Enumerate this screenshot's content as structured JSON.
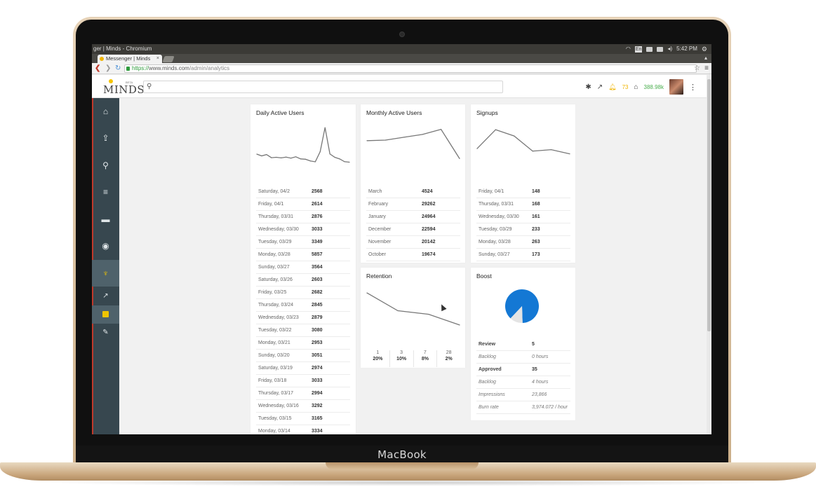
{
  "os": {
    "window_title": "ger | Minds - Chromium",
    "time": "5:42 PM",
    "keyboard": "En"
  },
  "browser": {
    "tab_title": "Messenger | Minds",
    "tab_close": "×",
    "url_scheme": "https://",
    "url_host": "www.minds.com",
    "url_path": "/admin/analytics"
  },
  "header": {
    "logo_text": "MINDS",
    "logo_badge": "BETA",
    "search_placeholder": "",
    "notifications": "73",
    "points": "388.98k"
  },
  "sidebar": {
    "items": [
      "home-icon",
      "upload-icon",
      "search-icon",
      "newsfeed-icon",
      "messenger-icon",
      "gatherings-icon",
      "admin-icon",
      "analytics-icon",
      "boost-admin-icon",
      "edit-icon"
    ]
  },
  "dau": {
    "title": "Daily Active Users",
    "rows": [
      {
        "label": "Saturday, 04/2",
        "value": "2568"
      },
      {
        "label": "Friday, 04/1",
        "value": "2614"
      },
      {
        "label": "Thursday, 03/31",
        "value": "2876"
      },
      {
        "label": "Wednesday, 03/30",
        "value": "3033"
      },
      {
        "label": "Tuesday, 03/29",
        "value": "3349"
      },
      {
        "label": "Monday, 03/28",
        "value": "5857"
      },
      {
        "label": "Sunday, 03/27",
        "value": "3564"
      },
      {
        "label": "Saturday, 03/26",
        "value": "2603"
      },
      {
        "label": "Friday, 03/25",
        "value": "2682"
      },
      {
        "label": "Thursday, 03/24",
        "value": "2845"
      },
      {
        "label": "Wednesday, 03/23",
        "value": "2879"
      },
      {
        "label": "Tuesday, 03/22",
        "value": "3080"
      },
      {
        "label": "Monday, 03/21",
        "value": "2953"
      },
      {
        "label": "Sunday, 03/20",
        "value": "3051"
      },
      {
        "label": "Saturday, 03/19",
        "value": "2974"
      },
      {
        "label": "Friday, 03/18",
        "value": "3033"
      },
      {
        "label": "Thursday, 03/17",
        "value": "2994"
      },
      {
        "label": "Wednesday, 03/16",
        "value": "3292"
      },
      {
        "label": "Tuesday, 03/15",
        "value": "3165"
      },
      {
        "label": "Monday, 03/14",
        "value": "3334"
      }
    ]
  },
  "mau": {
    "title": "Monthly Active Users",
    "rows": [
      {
        "label": "March",
        "value": "4524"
      },
      {
        "label": "February",
        "value": "29262"
      },
      {
        "label": "January",
        "value": "24964"
      },
      {
        "label": "December",
        "value": "22594"
      },
      {
        "label": "November",
        "value": "20142"
      },
      {
        "label": "October",
        "value": "19674"
      }
    ]
  },
  "signups": {
    "title": "Signups",
    "rows": [
      {
        "label": "Friday, 04/1",
        "value": "148"
      },
      {
        "label": "Thursday, 03/31",
        "value": "168"
      },
      {
        "label": "Wednesday, 03/30",
        "value": "161"
      },
      {
        "label": "Tuesday, 03/29",
        "value": "233"
      },
      {
        "label": "Monday, 03/28",
        "value": "263"
      },
      {
        "label": "Sunday, 03/27",
        "value": "173"
      }
    ]
  },
  "retention": {
    "title": "Retention",
    "cols": [
      {
        "day": "1",
        "pct": "20%"
      },
      {
        "day": "3",
        "pct": "10%"
      },
      {
        "day": "7",
        "pct": "8%"
      },
      {
        "day": "28",
        "pct": "2%"
      }
    ]
  },
  "boost": {
    "title": "Boost",
    "rows": [
      {
        "label": "Review",
        "value": "5",
        "style": "bold"
      },
      {
        "label": "Backlog",
        "value": "0 hours",
        "style": "italic"
      },
      {
        "label": "Approved",
        "value": "35",
        "style": "bold"
      },
      {
        "label": "Backlog",
        "value": "4 hours",
        "style": "italic"
      },
      {
        "label": "Impressions",
        "value": "23,866",
        "style": "italic"
      },
      {
        "label": "Burn rate",
        "value": "3,974.072 / hour",
        "style": "italic"
      }
    ]
  },
  "laptop": {
    "brand": "MacBook"
  },
  "chart_data": [
    {
      "type": "line",
      "title": "Daily Active Users",
      "categories": [
        "Monday, 03/14",
        "Tuesday, 03/15",
        "Wednesday, 03/16",
        "Thursday, 03/17",
        "Friday, 03/18",
        "Saturday, 03/19",
        "Sunday, 03/20",
        "Monday, 03/21",
        "Tuesday, 03/22",
        "Wednesday, 03/23",
        "Thursday, 03/24",
        "Friday, 03/25",
        "Saturday, 03/26",
        "Sunday, 03/27",
        "Monday, 03/28",
        "Tuesday, 03/29",
        "Wednesday, 03/30",
        "Thursday, 03/31",
        "Friday, 04/1",
        "Saturday, 04/2"
      ],
      "values": [
        3334,
        3165,
        3292,
        2994,
        3033,
        2974,
        3051,
        2953,
        3080,
        2879,
        2845,
        2682,
        2603,
        3564,
        5857,
        3349,
        3033,
        2876,
        2614,
        2568
      ],
      "ylim": [
        2400,
        6000
      ]
    },
    {
      "type": "line",
      "title": "Monthly Active Users",
      "categories": [
        "October",
        "November",
        "December",
        "January",
        "February",
        "March"
      ],
      "values": [
        19674,
        20142,
        22594,
        24964,
        29262,
        4524
      ],
      "ylim": [
        0,
        32000
      ]
    },
    {
      "type": "line",
      "title": "Signups",
      "categories": [
        "Sunday, 03/27",
        "Monday, 03/28",
        "Tuesday, 03/29",
        "Wednesday, 03/30",
        "Thursday, 03/31",
        "Friday, 04/1"
      ],
      "values": [
        173,
        263,
        233,
        161,
        168,
        148
      ],
      "ylim": [
        100,
        280
      ]
    },
    {
      "type": "line",
      "title": "Retention",
      "categories": [
        "1",
        "3",
        "7",
        "28"
      ],
      "values": [
        20,
        10,
        8,
        2
      ],
      "ylim": [
        0,
        22
      ]
    },
    {
      "type": "pie",
      "title": "Boost",
      "categories": [
        "Approved",
        "Review"
      ],
      "values": [
        35,
        5
      ],
      "colors": [
        "#1478d4",
        "#e4e4e4"
      ]
    }
  ]
}
